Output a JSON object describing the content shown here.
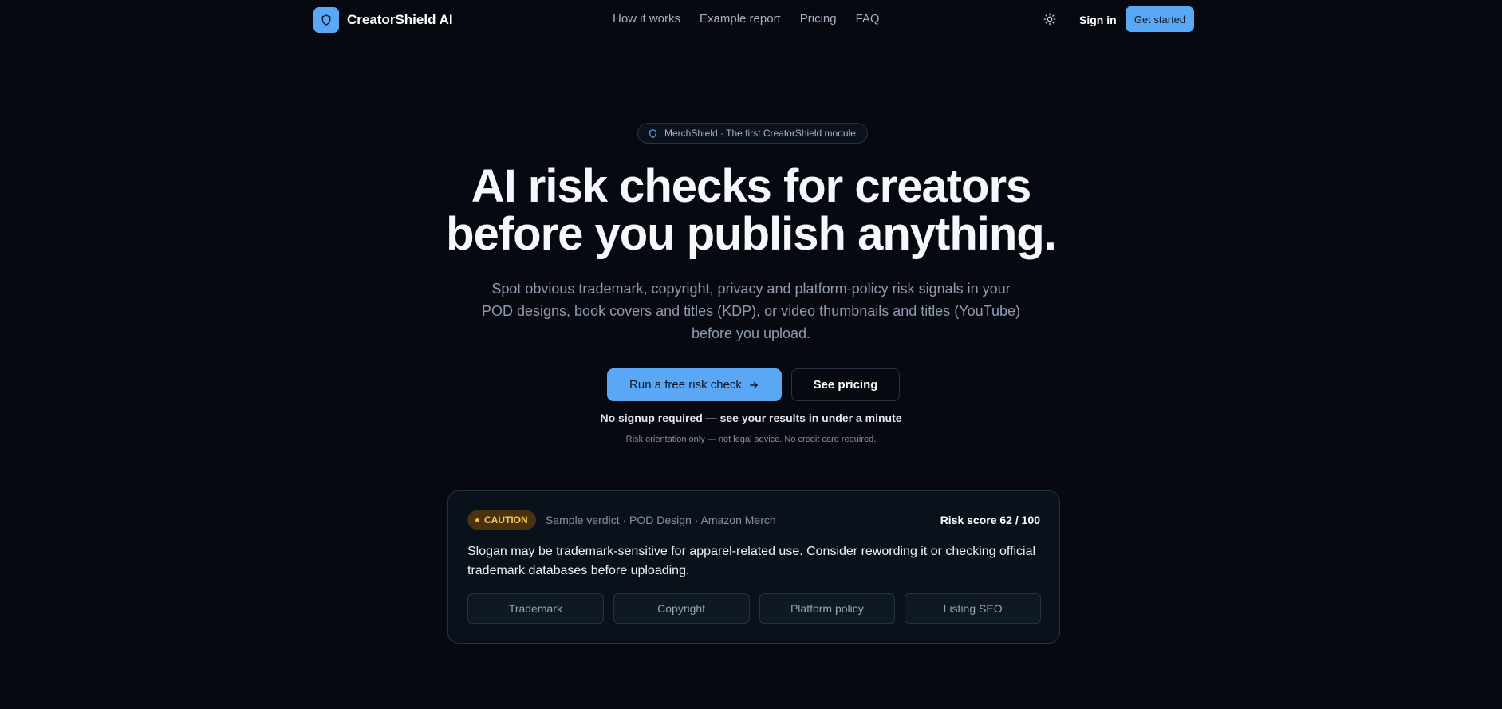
{
  "brand": {
    "name": "CreatorShield AI",
    "logo_icon": "shield-icon"
  },
  "nav": {
    "items": [
      "How it works",
      "Example report",
      "Pricing",
      "FAQ"
    ],
    "theme_icon": "sun-icon",
    "sign_in": "Sign in",
    "get_started": "Get started"
  },
  "hero": {
    "pill_icon": "shield-icon",
    "pill_text": "MerchShield · The first CreatorShield module",
    "title_line1": "AI risk checks for creators",
    "title_line2": "before you publish anything.",
    "subtitle": "Spot obvious trademark, copyright, privacy and platform-policy risk signals in your POD designs, book covers and titles (KDP), or video thumbnails and titles (YouTube) before you upload.",
    "cta_primary": "Run a free risk check",
    "cta_primary_icon": "arrow-right-icon",
    "cta_secondary": "See pricing",
    "note_main": "No signup required — see your results in under a minute",
    "note_small": "Risk orientation only — not legal advice. No credit card required."
  },
  "sample_card": {
    "badge": "CAUTION",
    "label": "Sample verdict · POD Design · Amazon Merch",
    "risk_score": "Risk score 62 / 100",
    "verdict": "Slogan may be trademark-sensitive for apparel-related use. Consider rewording it or checking official trademark databases before uploading.",
    "chips": [
      "Trademark",
      "Copyright",
      "Platform policy",
      "Listing SEO"
    ]
  },
  "colors": {
    "accent": "#5aa8f5",
    "background": "#060a10",
    "caution": "#f6c75a"
  }
}
